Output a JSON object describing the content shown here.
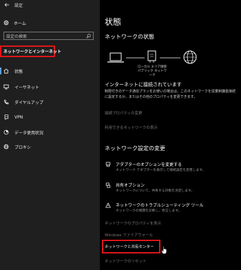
{
  "window": {
    "title": "設定"
  },
  "sidebar": {
    "home_label": "ホーム",
    "search_placeholder": "設定の検索",
    "section_title": "ネットワークとインターネット",
    "items": [
      {
        "label": "状態",
        "icon": "home-network-icon"
      },
      {
        "label": "イーサネット",
        "icon": "ethernet-icon"
      },
      {
        "label": "ダイヤルアップ",
        "icon": "phone-icon"
      },
      {
        "label": "VPN",
        "icon": "vpn-icon"
      },
      {
        "label": "データ使用状況",
        "icon": "data-usage-icon"
      },
      {
        "label": "プロキシ",
        "icon": "globe-icon"
      }
    ]
  },
  "main": {
    "title": "状態",
    "network_status_heading": "ネットワークの状態",
    "diagram_label_line1": "ローカル エリア接続",
    "diagram_label_line2": "パブリック ネットワーク",
    "status_heading": "インターネットに接続されています",
    "status_description": "制限付きのデータ通信プランをお使いの場合は、このネットワークを従量制課金接続に設定するか、またはその他のプロパティを変更できます。",
    "link_change_properties": "接続プロパティの変更",
    "link_show_networks": "利用できるネットワークの表示",
    "change_settings_heading": "ネットワーク設定の変更",
    "settings": [
      {
        "title": "アダプターのオプションを変更する",
        "desc": "ネットワーク アダプターを表示して接続設定を変更します。",
        "icon": "adapter-icon"
      },
      {
        "title": "共有オプション",
        "desc": "ネットワークについて、共有する対象を決定します。",
        "icon": "sharing-icon"
      },
      {
        "title": "ネットワークのトラブルシューティング ツール",
        "desc": "ネットワークの問題を診断し、修正します。",
        "icon": "warning-icon"
      }
    ],
    "link_view_properties": "ネットワークのプロパティを表示",
    "link_firewall": "Windows ファイアウォール",
    "link_sharing_center": "ネットワークと共有センター",
    "link_reset": "ネットワークのリセット"
  }
}
